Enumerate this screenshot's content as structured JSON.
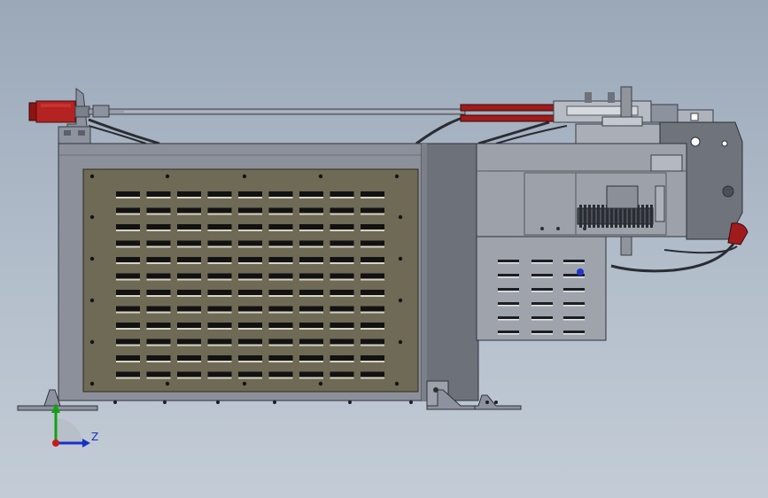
{
  "triad": {
    "z_label": "Z"
  },
  "colors": {
    "background_top": "#9aa8b8",
    "background_bottom": "#c3ccd6",
    "frame_gray": "#8a8f9a",
    "panel_olive": "#6f6a55",
    "cylinder_red": "#b02020",
    "axis_green": "#14a014",
    "axis_blue": "#1a2fc8",
    "axis_red": "#c81a1a"
  },
  "icons": [
    "hydraulic-cylinder-icon",
    "gear-icon",
    "coordinate-triad-icon"
  ]
}
